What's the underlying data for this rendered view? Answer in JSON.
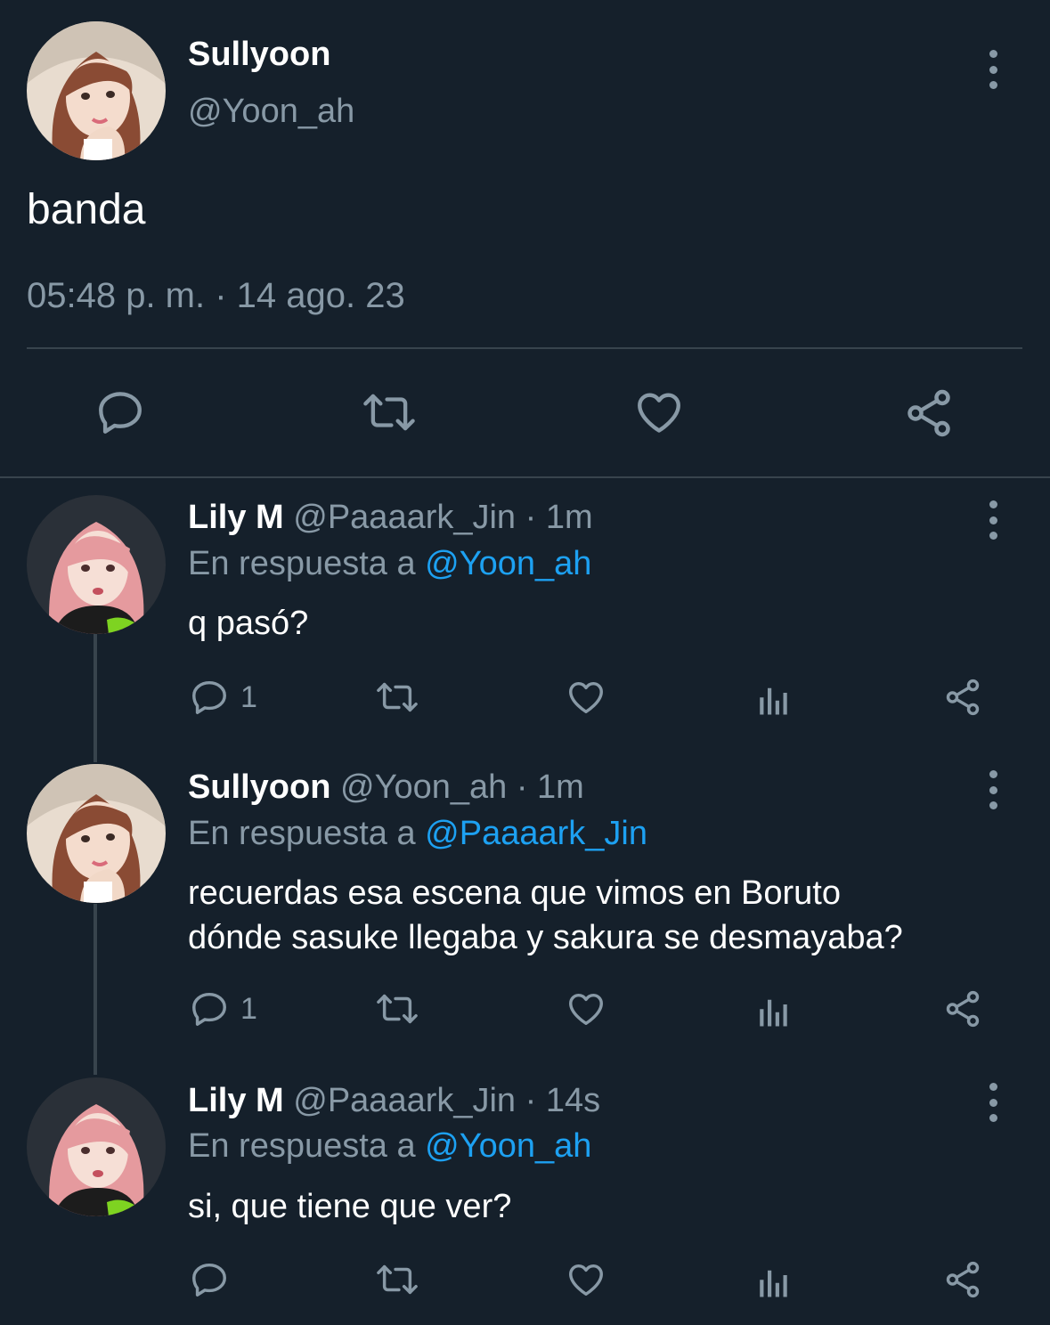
{
  "main_tweet": {
    "author_name": "Sullyoon",
    "author_handle": "@Yoon_ah",
    "text": "banda",
    "timestamp": "05:48 p. m. · 14 ago. 23",
    "avatar_icon": "avatar-sullyoon",
    "actions": [
      "reply-icon",
      "retweet-icon",
      "like-icon",
      "share-icon"
    ]
  },
  "replies": [
    {
      "name": "Lily M",
      "handle": "@Paaaark_Jin",
      "separator": " · ",
      "time": "1m",
      "reply_prefix": "En respuesta a ",
      "reply_to": "@Yoon_ah",
      "text_lines": [
        "q pasó?"
      ],
      "reply_count": "1"
    },
    {
      "name": "Sullyoon",
      "handle": "@Yoon_ah",
      "separator": " · ",
      "time": "1m",
      "reply_prefix": "En respuesta a ",
      "reply_to": "@Paaaark_Jin",
      "text_lines": [
        "recuerdas esa escena que vimos en Boruto",
        "dónde sasuke llegaba y sakura se desmayaba?"
      ],
      "reply_count": "1"
    },
    {
      "name": "Lily M",
      "handle": "@Paaaark_Jin",
      "separator": " · ",
      "time": "14s",
      "reply_prefix": "En respuesta a ",
      "reply_to": "@Yoon_ah",
      "text_lines": [
        "si, que tiene que ver?"
      ],
      "reply_count": ""
    }
  ],
  "colors": {
    "background": "#15202b",
    "secondary_text": "#8899a6",
    "accent": "#1da1f2",
    "divider": "#38444d"
  }
}
